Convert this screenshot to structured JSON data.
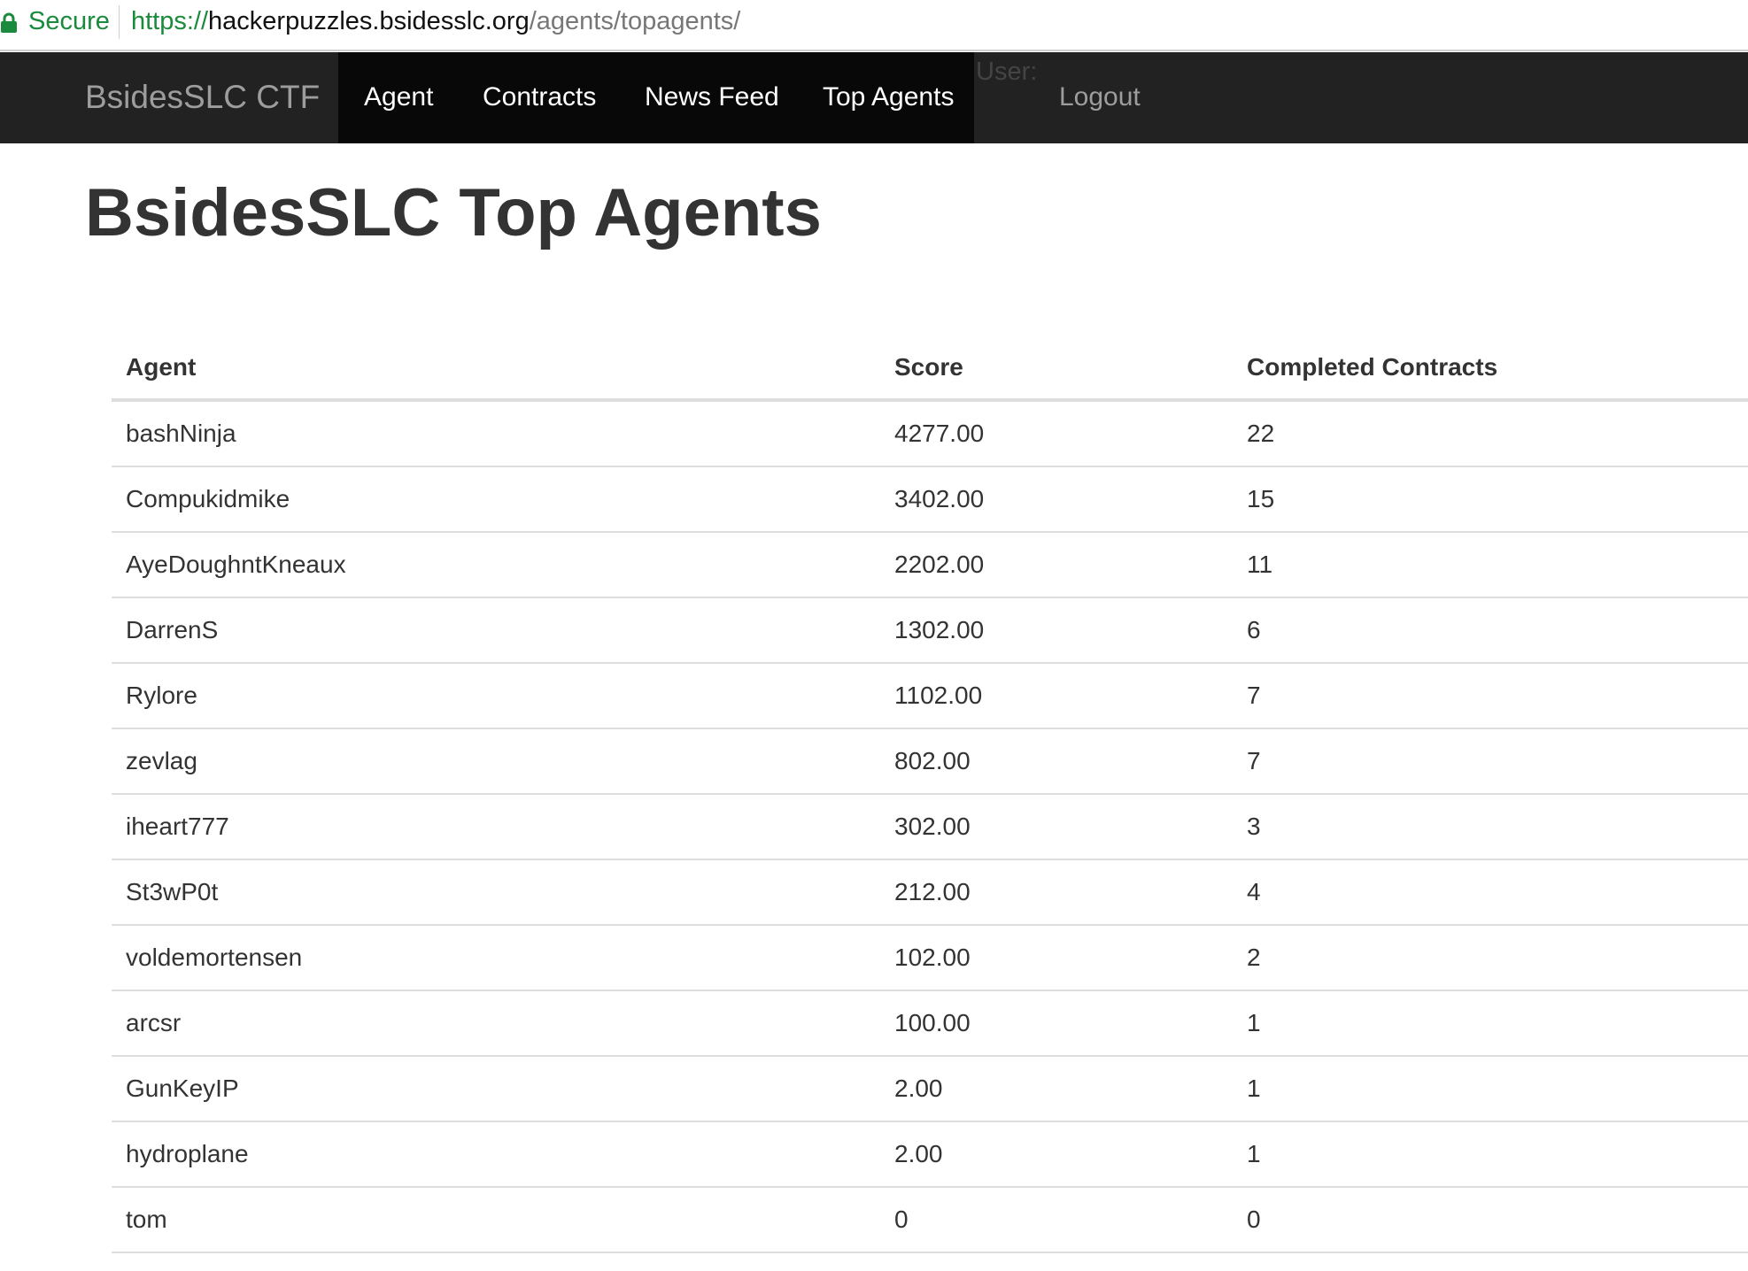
{
  "browser": {
    "secure_label": "Secure",
    "url_scheme": "https://",
    "url_host": "hackerpuzzles.bsidesslc.org",
    "url_path": "/agents/topagents/"
  },
  "navbar": {
    "brand": "BsidesSLC CTF",
    "items": [
      {
        "label": "Agent"
      },
      {
        "label": "Contracts"
      },
      {
        "label": "News Feed"
      },
      {
        "label": "Top Agents"
      }
    ],
    "user_label": "User:",
    "logout_label": "Logout"
  },
  "page": {
    "title": "BsidesSLC Top Agents"
  },
  "table": {
    "headers": [
      "Agent",
      "Score",
      "Completed Contracts"
    ],
    "rows": [
      [
        "bashNinja",
        "4277.00",
        "22"
      ],
      [
        "Compukidmike",
        "3402.00",
        "15"
      ],
      [
        "AyeDoughntKneaux",
        "2202.00",
        "11"
      ],
      [
        "DarrenS",
        "1302.00",
        "6"
      ],
      [
        "Rylore",
        "1102.00",
        "7"
      ],
      [
        "zevlag",
        "802.00",
        "7"
      ],
      [
        "iheart777",
        "302.00",
        "3"
      ],
      [
        "St3wP0t",
        "212.00",
        "4"
      ],
      [
        "voldemortensen",
        "102.00",
        "2"
      ],
      [
        "arcsr",
        "100.00",
        "1"
      ],
      [
        "GunKeyIP",
        "2.00",
        "1"
      ],
      [
        "hydroplane",
        "2.00",
        "1"
      ],
      [
        "tom",
        "0",
        "0"
      ]
    ]
  },
  "colors": {
    "navbar_bg": "#222222",
    "navbar_active_bg": "#080808",
    "secure_green": "#1a8a3c",
    "text": "#333333"
  }
}
